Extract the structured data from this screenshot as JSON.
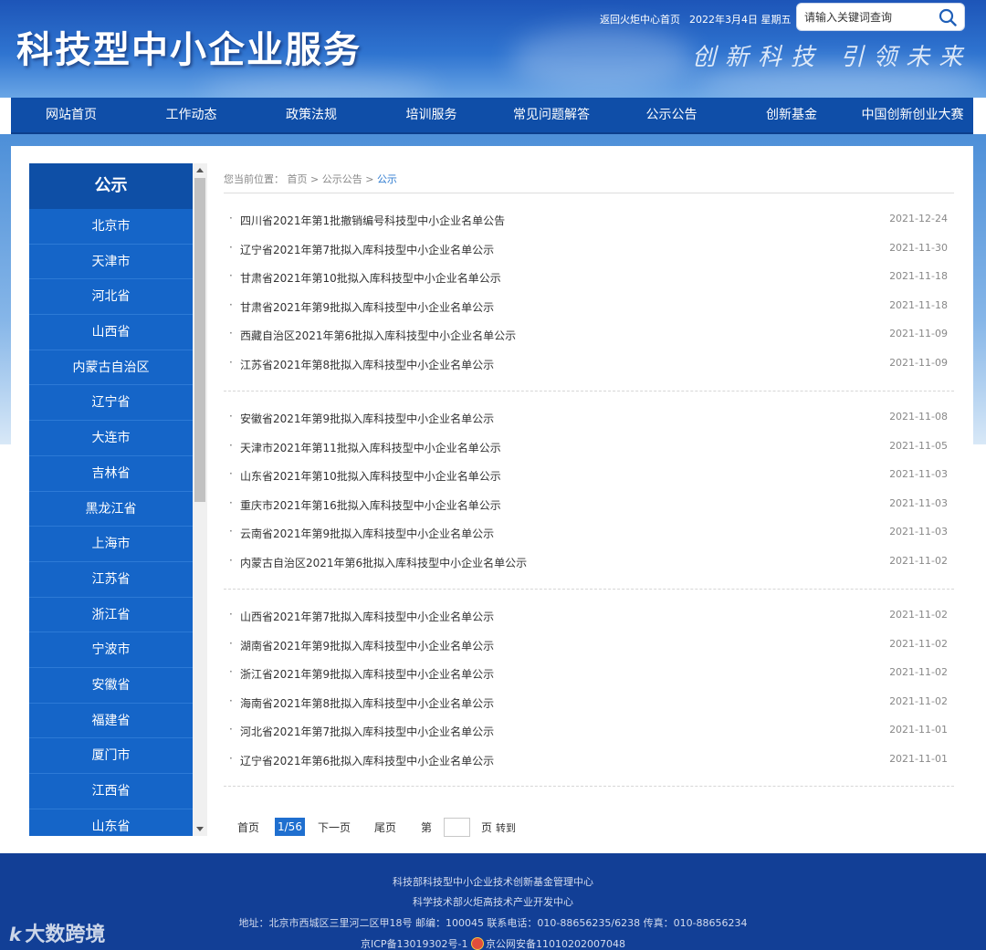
{
  "header": {
    "site_title": "科技型中小企业服务",
    "slogan": "创新科技 引领未来",
    "top_link_home": "返回火炬中心首页",
    "top_date": "2022年3月4日 星期五",
    "search_placeholder": "请输入关键词查询"
  },
  "nav": {
    "items": [
      "网站首页",
      "工作动态",
      "政策法规",
      "培训服务",
      "常见问题解答",
      "公示公告",
      "创新基金",
      "中国创新创业大赛"
    ]
  },
  "sidebar": {
    "title": "公示",
    "items": [
      "北京市",
      "天津市",
      "河北省",
      "山西省",
      "内蒙古自治区",
      "辽宁省",
      "大连市",
      "吉林省",
      "黑龙江省",
      "上海市",
      "江苏省",
      "浙江省",
      "宁波市",
      "安徽省",
      "福建省",
      "厦门市",
      "江西省",
      "山东省"
    ]
  },
  "breadcrumb": {
    "prefix": "您当前位置：",
    "home": "首页",
    "sep": ">",
    "section": "公示公告",
    "current": "公示"
  },
  "list": {
    "bullet": "·",
    "groups": [
      [
        {
          "title": "四川省2021年第1批撤销编号科技型中小企业名单公告",
          "date": "2021-12-24"
        },
        {
          "title": "辽宁省2021年第7批拟入库科技型中小企业名单公示",
          "date": "2021-11-30"
        },
        {
          "title": "甘肃省2021年第10批拟入库科技型中小企业名单公示",
          "date": "2021-11-18"
        },
        {
          "title": "甘肃省2021年第9批拟入库科技型中小企业名单公示",
          "date": "2021-11-18"
        },
        {
          "title": "西藏自治区2021年第6批拟入库科技型中小企业名单公示",
          "date": "2021-11-09"
        },
        {
          "title": "江苏省2021年第8批拟入库科技型中小企业名单公示",
          "date": "2021-11-09"
        }
      ],
      [
        {
          "title": "安徽省2021年第9批拟入库科技型中小企业名单公示",
          "date": "2021-11-08"
        },
        {
          "title": "天津市2021年第11批拟入库科技型中小企业名单公示",
          "date": "2021-11-05"
        },
        {
          "title": "山东省2021年第10批拟入库科技型中小企业名单公示",
          "date": "2021-11-03"
        },
        {
          "title": "重庆市2021年第16批拟入库科技型中小企业名单公示",
          "date": "2021-11-03"
        },
        {
          "title": "云南省2021年第9批拟入库科技型中小企业名单公示",
          "date": "2021-11-03"
        },
        {
          "title": "内蒙古自治区2021年第6批拟入库科技型中小企业名单公示",
          "date": "2021-11-02"
        }
      ],
      [
        {
          "title": "山西省2021年第7批拟入库科技型中小企业名单公示",
          "date": "2021-11-02"
        },
        {
          "title": "湖南省2021年第9批拟入库科技型中小企业名单公示",
          "date": "2021-11-02"
        },
        {
          "title": "浙江省2021年第9批拟入库科技型中小企业名单公示",
          "date": "2021-11-02"
        },
        {
          "title": "海南省2021年第8批拟入库科技型中小企业名单公示",
          "date": "2021-11-02"
        },
        {
          "title": "河北省2021年第7批拟入库科技型中小企业名单公示",
          "date": "2021-11-01"
        },
        {
          "title": "辽宁省2021年第6批拟入库科技型中小企业名单公示",
          "date": "2021-11-01"
        }
      ]
    ]
  },
  "pager": {
    "first": "首页",
    "current": "1/56",
    "next": "下一页",
    "last": "尾页",
    "goto_prefix": "第",
    "goto_input": "",
    "goto_suffix": "页",
    "goto_button": "转到"
  },
  "footer": {
    "line1": "科技部科技型中小企业技术创新基金管理中心",
    "line2": "科学技术部火炬高技术产业开发中心",
    "line3": "地址：北京市西城区三里河二区甲18号 邮编：100045 联系电话：010-88656235/6238 传真：010-88656234",
    "icp": "京ICP备13019302号-1",
    "police": "京公网安备11010202007048",
    "watermark": "大数跨境",
    "watermark_logo": "k"
  },
  "colors": {
    "nav_bg": "#0f4ea8",
    "sidebar_bg": "#1565c8",
    "footer_bg": "#123f96",
    "accent": "#1f6fcf"
  }
}
